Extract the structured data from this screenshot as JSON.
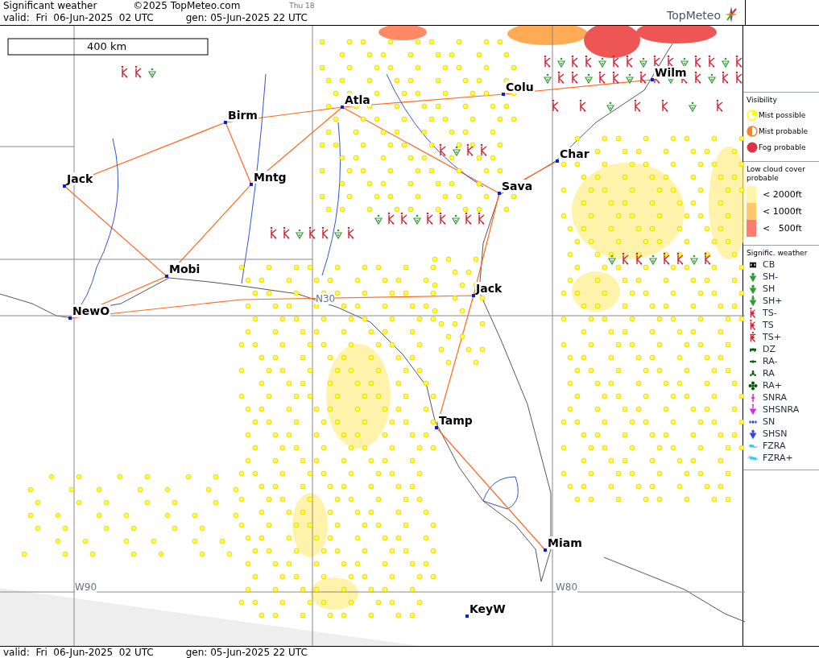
{
  "header": {
    "title": "Significant weather",
    "copyright": "©2025 TopMeteo.com",
    "time_label": "Thu 18",
    "valid": "valid:  Fri  06-Jun-2025  02 UTC",
    "generated": "gen: 05-Jun-2025 22 UTC",
    "brand": "TopMeteo"
  },
  "map": {
    "scale": "400 km",
    "cities": [
      "Wilm",
      "Colu",
      "Atla",
      "Birm",
      "Char",
      "Jack",
      "Mntg",
      "Sava",
      "Mobi",
      "Jack",
      "NewO",
      "Tamp",
      "Miam",
      "KeyW"
    ],
    "grid_labels": [
      "N30",
      "W90",
      "W80"
    ]
  },
  "legend": {
    "visibility": {
      "title": "Visibility",
      "items": [
        {
          "label": "Mist possible",
          "kind": "half",
          "color": "#ffff00"
        },
        {
          "label": "Mist probable",
          "kind": "split",
          "color": "#ff8020"
        },
        {
          "label": "Fog probable",
          "kind": "full",
          "color": "#dd3344"
        }
      ]
    },
    "low_cloud": {
      "title": "Low cloud cover probable",
      "items": [
        {
          "label": "< 2000ft",
          "color": "#fff5a8"
        },
        {
          "label": "< 1000ft",
          "color": "#ffc870"
        },
        {
          "label": "<   500ft",
          "color": "#ff7a70"
        }
      ]
    },
    "weather": {
      "title": "Signific. weather",
      "items": [
        {
          "label": "CB",
          "kind": "cb",
          "color": "#000000"
        },
        {
          "label": "SH-",
          "kind": "shower-light",
          "color": "#339933"
        },
        {
          "label": "SH",
          "kind": "shower",
          "color": "#339933"
        },
        {
          "label": "SH+",
          "kind": "shower-heavy",
          "color": "#339933"
        },
        {
          "label": "TS-",
          "kind": "ts-light",
          "color": "#cc2233"
        },
        {
          "label": "TS",
          "kind": "ts",
          "color": "#cc2233"
        },
        {
          "label": "TS+",
          "kind": "ts-heavy",
          "color": "#cc2233"
        },
        {
          "label": "DZ",
          "kind": "drizzle",
          "color": "#005500"
        },
        {
          "label": "RA-",
          "kind": "rain-light",
          "color": "#005500"
        },
        {
          "label": "RA",
          "kind": "rain",
          "color": "#005500"
        },
        {
          "label": "RA+",
          "kind": "rain-heavy",
          "color": "#005500"
        },
        {
          "label": "SNRA",
          "kind": "snow-rain",
          "color": "#cc33dd"
        },
        {
          "label": "SHSNRA",
          "kind": "snow-rain-shower",
          "color": "#cc33dd"
        },
        {
          "label": "SN",
          "kind": "snow",
          "color": "#3344dd"
        },
        {
          "label": "SHSN",
          "kind": "snow-shower",
          "color": "#3344dd"
        },
        {
          "label": "FZRA",
          "kind": "freezing-rain",
          "color": "#22ccee"
        },
        {
          "label": "FZRA+",
          "kind": "freezing-rain-heavy",
          "color": "#22ccee"
        }
      ]
    }
  },
  "footer": {
    "valid": "valid:  Fri  06-Jun-2025  02 UTC",
    "generated": "gen: 05-Jun-2025 22 UTC"
  }
}
